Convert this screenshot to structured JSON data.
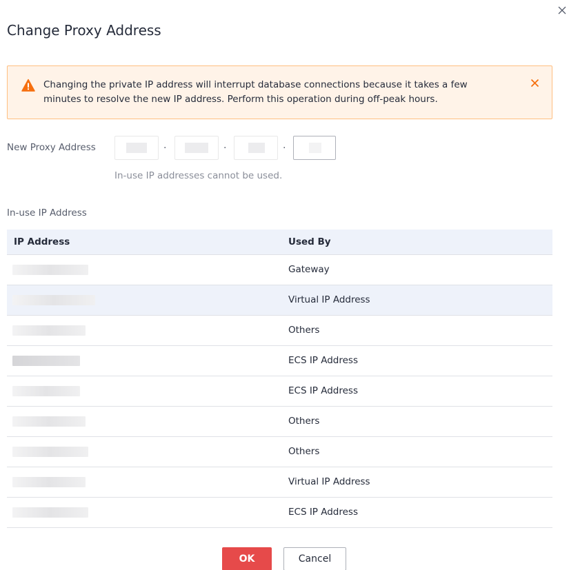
{
  "dialog": {
    "title": "Change Proxy Address",
    "close_icon": "close-icon"
  },
  "alert": {
    "icon": "warning-icon",
    "message": "Changing the private IP address will interrupt database connections because it takes a few minutes to resolve the new IP address. Perform this operation during off-peak hours.",
    "close_icon": "close-icon",
    "color": "#f66f0f"
  },
  "proxy_field": {
    "label": "New Proxy Address",
    "separator": "·",
    "octets": [
      "",
      "",
      "",
      ""
    ],
    "hint": "In-use IP addresses cannot be used."
  },
  "in_use": {
    "label": "In-use IP Address",
    "columns": [
      "IP Address",
      "Used By"
    ],
    "rows": [
      {
        "ip": "",
        "used_by": "Gateway"
      },
      {
        "ip": "",
        "used_by": "Virtual IP Address"
      },
      {
        "ip": "",
        "used_by": "Others"
      },
      {
        "ip": "",
        "used_by": "ECS IP Address"
      },
      {
        "ip": "",
        "used_by": "ECS IP Address"
      },
      {
        "ip": "",
        "used_by": "Others"
      },
      {
        "ip": "",
        "used_by": "Others"
      },
      {
        "ip": "",
        "used_by": "Virtual IP Address"
      },
      {
        "ip": "",
        "used_by": "ECS IP Address"
      }
    ]
  },
  "footer": {
    "ok_label": "OK",
    "cancel_label": "Cancel",
    "ok_color": "#e64a4a"
  }
}
